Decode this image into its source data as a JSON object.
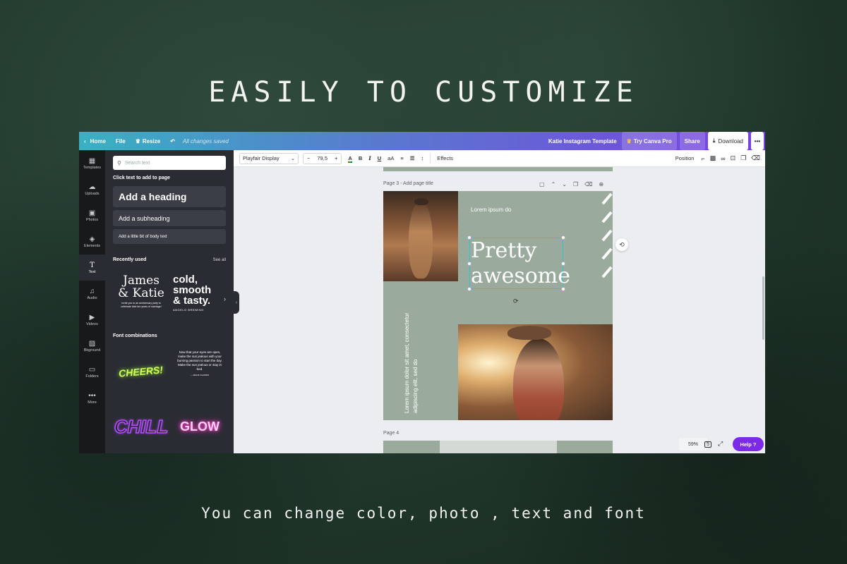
{
  "headline": "EASILY TO CUSTOMIZE",
  "caption": "You can change color, photo , text and font",
  "topbar": {
    "home": "Home",
    "file": "File",
    "resize": "Resize",
    "saved": "All changes saved",
    "template_title": "Katie Instagram Template",
    "try_pro": "Try Canva Pro",
    "share": "Share",
    "download": "Download",
    "more": "•••"
  },
  "rail": [
    {
      "label": "Templates",
      "icon": "templates-icon"
    },
    {
      "label": "Uploads",
      "icon": "upload-icon"
    },
    {
      "label": "Photos",
      "icon": "photo-icon"
    },
    {
      "label": "Elements",
      "icon": "elements-icon"
    },
    {
      "label": "Text",
      "icon": "text-icon"
    },
    {
      "label": "Audio",
      "icon": "music-icon"
    },
    {
      "label": "Videos",
      "icon": "video-icon"
    },
    {
      "label": "Bkground",
      "icon": "background-icon"
    },
    {
      "label": "Folders",
      "icon": "folder-icon"
    },
    {
      "label": "More",
      "icon": "more-icon"
    }
  ],
  "panel": {
    "search_placeholder": "Search text",
    "click_hint": "Click text to add to page",
    "add_heading": "Add a heading",
    "add_subheading": "Add a subheading",
    "add_body": "Add a little bit of body text",
    "recently_used": "Recently used",
    "see_all": "See all",
    "font_combinations": "Font combinations",
    "thumb1_line1": "James",
    "thumb1_line2": "& Katie",
    "thumb1_small": "Invite you to an anniversary party to celebrate their ten years of marriage!",
    "thumb2_line1": "cold,",
    "thumb2_line2": "smooth",
    "thumb2_line3": "& tasty.",
    "thumb2_small": "ANGELO BREWING",
    "cheers": "CHEERS!",
    "sun_text": "Now that your eyes are open, make the sun jealous with your burning passion to start the day. Make the sun jealous or stay in bed.",
    "sun_credit": "— MALIK OLANDO",
    "chill": "CHILL",
    "glow": "GLOW"
  },
  "toolbar": {
    "font": "Playfair Display",
    "minus": "−",
    "size": "79,5",
    "plus": "+",
    "bold": "B",
    "italic": "I",
    "underline": "U",
    "case": "aA",
    "effects": "Effects",
    "position": "Position"
  },
  "canvas": {
    "page3_label": "Page 3 - Add page title",
    "lorem_top": "Lorem ipsum do",
    "heading_line1": "Pretty",
    "heading_line2": "awesome",
    "vertical_text": "Lorem ipsum dolor sit amet, consectetur adipiscing elit, sed do",
    "page4_label": "Page 4"
  },
  "footer": {
    "zoom": "59%",
    "page_count": "5",
    "help": "Help ?"
  },
  "colors": {
    "accent": "#7d2ae8",
    "sage": "#9aab9d",
    "panel": "#2a2c33"
  }
}
